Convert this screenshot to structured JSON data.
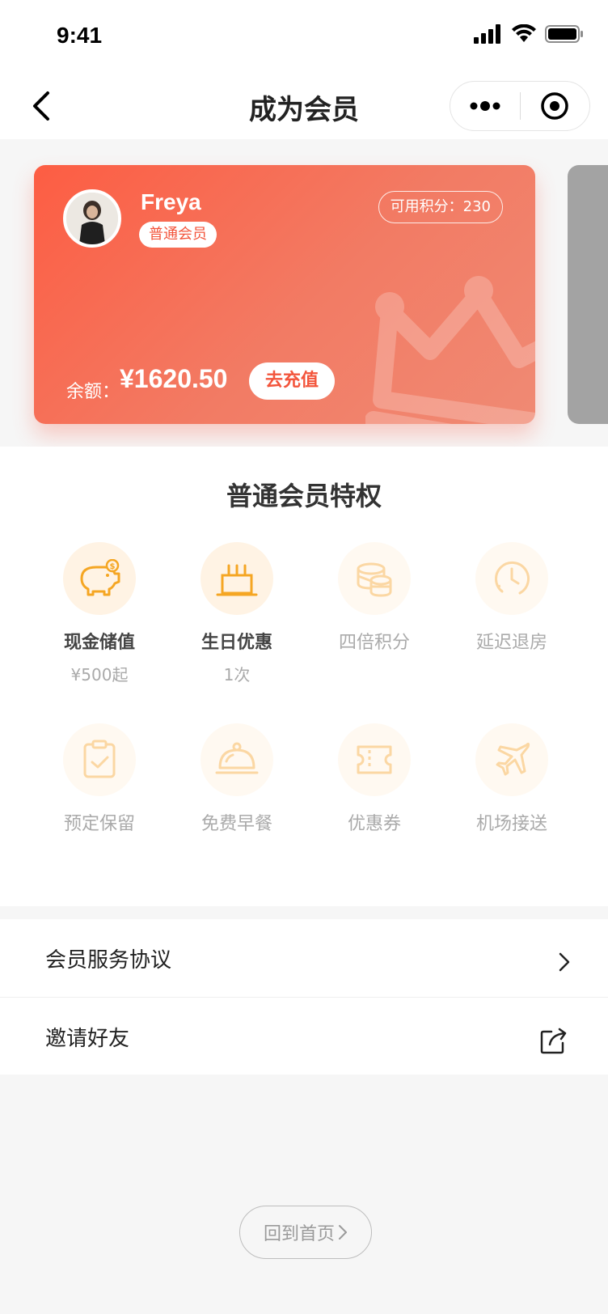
{
  "status_bar": {
    "time": "9:41"
  },
  "nav": {
    "title": "成为会员"
  },
  "card": {
    "user_name": "Freya",
    "level": "普通会员",
    "points": "可用积分：230",
    "balance_label": "余额：",
    "balance_amount": "¥1620.50",
    "recharge_label": "去充值",
    "accent_color": "#fd5d43"
  },
  "privileges": {
    "title": "普通会员特权",
    "items": [
      {
        "label": "现金储值",
        "sub": "¥500起",
        "icon": "piggy-bank-icon",
        "active": true
      },
      {
        "label": "生日优惠",
        "sub": "1次",
        "icon": "birthday-cake-icon",
        "active": true
      },
      {
        "label": "四倍积分",
        "sub": "",
        "icon": "coins-icon",
        "active": false
      },
      {
        "label": "延迟退房",
        "sub": "",
        "icon": "clock-icon",
        "active": false
      },
      {
        "label": "预定保留",
        "sub": "",
        "icon": "clipboard-check-icon",
        "active": false
      },
      {
        "label": "免费早餐",
        "sub": "",
        "icon": "food-cloche-icon",
        "active": false
      },
      {
        "label": "优惠券",
        "sub": "",
        "icon": "coupon-icon",
        "active": false
      },
      {
        "label": "机场接送",
        "sub": "",
        "icon": "airplane-icon",
        "active": false
      }
    ]
  },
  "list": {
    "agreement": "会员服务协议",
    "invite": "邀请好友"
  },
  "home_button": "回到首页"
}
